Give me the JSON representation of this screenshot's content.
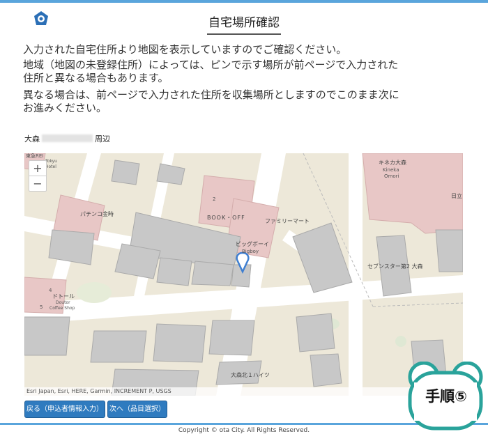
{
  "header": {
    "logo_icon": "city-emblem-icon",
    "title": "自宅場所確認"
  },
  "instructions": {
    "p1": "入力された自宅住所より地図を表示していますのでご確認ください。",
    "p2": "地域（地図の未登録住所）によっては、ピンで示す場所が前ページで入力された住所と異なる場合もあります。",
    "p3": "異なる場合は、前ページで入力された住所を収集場所としますのでこのまま次にお進みください。"
  },
  "address": {
    "prefix": "大森",
    "suffix": "周辺"
  },
  "map": {
    "zoom_in": "+",
    "zoom_out": "−",
    "attribution": "Esri Japan, Esri, HERE, Garmin, INCREMENT P, USGS",
    "marker_icon": "location-pin-icon",
    "labels": {
      "bookoff_num": "2",
      "bookoff": "BOOK・OFF",
      "familymart": "ファミリーマート",
      "bigboy": "ビッグボーイ",
      "bigboy_en": "Bigboy",
      "pachinko": "パチンコ金時",
      "doutor": "ドトール",
      "doutor_en": "Doutor",
      "doutor_en2": "Coffee Shop",
      "kinekaomori": "キネカ大森",
      "kineka_en": "Kineka",
      "kineka_en2": "Omori",
      "seven": "セブンスター第2 大森",
      "hitachi": "日立",
      "omorikita": "大森北１ハイツ",
      "tokyu": "東急REI",
      "tokyu_en": "Tokyu",
      "tokyu_en2": "Hotel",
      "num4": "4",
      "num5": "5"
    }
  },
  "buttons": {
    "back": "戻る（申込者情報入力）",
    "next": "次へ（品目選択）"
  },
  "footer": {
    "copyright": "Copyright © ota City. All Rights Reserved."
  },
  "badge": {
    "text": "手順⑤"
  }
}
